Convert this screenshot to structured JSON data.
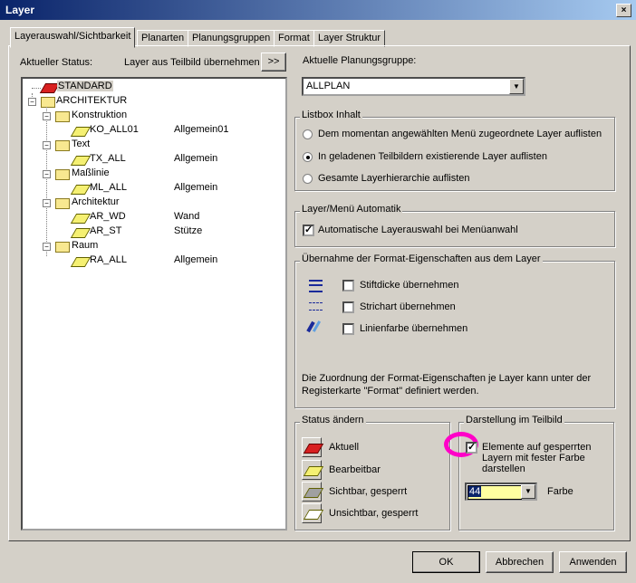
{
  "window": {
    "title": "Layer",
    "close": "×"
  },
  "tabs": [
    "Layerauswahl/Sichtbarkeit",
    "Planarten",
    "Planungsgruppen",
    "Format",
    "Layer Struktur"
  ],
  "left": {
    "status_label": "Aktueller Status:",
    "take_label": "Layer aus Teilbild übernehmen",
    "take_button": ">>"
  },
  "tree": {
    "standard": "STANDARD",
    "architektur": "ARCHITEKTUR",
    "groups": [
      {
        "name": "Konstruktion",
        "items": [
          {
            "name": "KO_ALL01",
            "format": "Allgemein01"
          }
        ]
      },
      {
        "name": "Text",
        "items": [
          {
            "name": "TX_ALL",
            "format": "Allgemein"
          }
        ]
      },
      {
        "name": "Maßlinie",
        "items": [
          {
            "name": "ML_ALL",
            "format": "Allgemein"
          }
        ]
      },
      {
        "name": "Architektur",
        "items": [
          {
            "name": "AR_WD",
            "format": "Wand"
          },
          {
            "name": "AR_ST",
            "format": "Stütze"
          }
        ]
      },
      {
        "name": "Raum",
        "items": [
          {
            "name": "RA_ALL",
            "format": "Allgemein"
          }
        ]
      }
    ],
    "expand_symbol": "−"
  },
  "planning_group": {
    "label": "Aktuelle Planungsgruppe:",
    "value": "ALLPLAN",
    "arrow": "▼"
  },
  "listbox": {
    "title": "Listbox Inhalt",
    "options": [
      "Dem momentan angewählten Menü zugeordnete Layer auflisten",
      "In geladenen Teilbildern existierende Layer auflisten",
      "Gesamte Layerhierarchie auflisten"
    ],
    "selected": 1
  },
  "automatik": {
    "title": "Layer/Menü Automatik",
    "checkbox_label": "Automatische Layerauswahl bei Menüanwahl",
    "checked_mark": "✓"
  },
  "format_props": {
    "title": "Übernahme der Format-Eigenschaften aus dem Layer",
    "items": [
      "Stiftdicke übernehmen",
      "Strichart übernehmen",
      "Linienfarbe übernehmen"
    ],
    "note": "Die Zuordnung der Format-Eigenschaften je Layer kann unter der Registerkarte \"Format\" definiert werden."
  },
  "status_change": {
    "title": "Status ändern",
    "items": [
      "Aktuell",
      "Bearbeitbar",
      "Sichtbar, gesperrt",
      "Unsichtbar, gesperrt"
    ]
  },
  "display": {
    "title": "Darstellung im Teilbild",
    "checkbox_label": "Elemente auf gesperrten Layern mit fester Farbe darstellen",
    "checked_mark": "✓",
    "color_value": "44",
    "color_label": "Farbe",
    "arrow": "▼",
    "swatch_color": "#ffffa0",
    "highlight_color": "#ff00c8"
  },
  "footer": {
    "ok": "OK",
    "cancel": "Abbrechen",
    "apply": "Anwenden"
  }
}
